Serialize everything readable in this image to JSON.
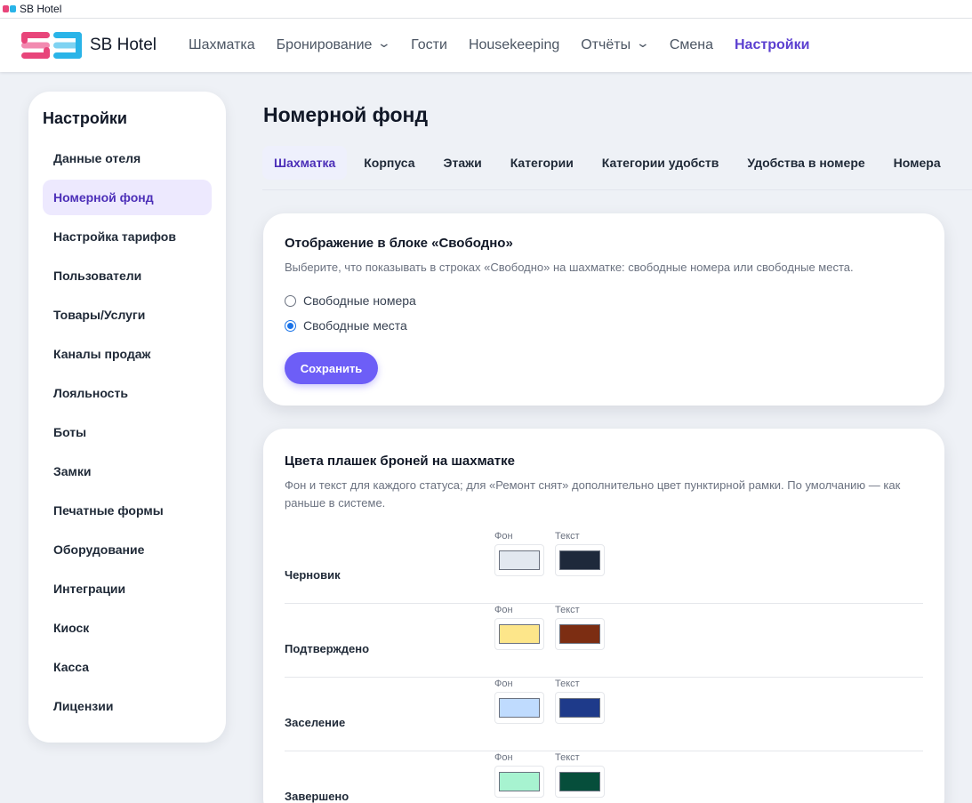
{
  "window": {
    "title": "SB Hotel"
  },
  "brand": {
    "name": "SB Hotel",
    "colors": {
      "pink": "#e8457a",
      "cyan": "#2ab4e8"
    }
  },
  "nav": {
    "items": [
      {
        "label": "Шахматка",
        "dropdown": false,
        "active": false
      },
      {
        "label": "Бронирование",
        "dropdown": true,
        "active": false
      },
      {
        "label": "Гости",
        "dropdown": false,
        "active": false
      },
      {
        "label": "Housekeeping",
        "dropdown": false,
        "active": false
      },
      {
        "label": "Отчёты",
        "dropdown": true,
        "active": false
      },
      {
        "label": "Смена",
        "dropdown": false,
        "active": false
      },
      {
        "label": "Настройки",
        "dropdown": false,
        "active": true
      }
    ]
  },
  "sidebar": {
    "title": "Настройки",
    "items": [
      {
        "label": "Данные отеля"
      },
      {
        "label": "Номерной фонд",
        "active": true
      },
      {
        "label": "Настройка тарифов"
      },
      {
        "label": "Пользователи"
      },
      {
        "label": "Товары/Услуги"
      },
      {
        "label": "Каналы продаж"
      },
      {
        "label": "Лояльность"
      },
      {
        "label": "Боты"
      },
      {
        "label": "Замки"
      },
      {
        "label": "Печатные формы"
      },
      {
        "label": "Оборудование"
      },
      {
        "label": "Интеграции"
      },
      {
        "label": "Киоск"
      },
      {
        "label": "Касса"
      },
      {
        "label": "Лицензии"
      }
    ]
  },
  "page": {
    "title": "Номерной фонд"
  },
  "tabs": [
    {
      "label": "Шахматка",
      "active": true
    },
    {
      "label": "Корпуса"
    },
    {
      "label": "Этажи"
    },
    {
      "label": "Категории"
    },
    {
      "label": "Категории удобств"
    },
    {
      "label": "Удобства в номере"
    },
    {
      "label": "Номера"
    }
  ],
  "free_display": {
    "title": "Отображение в блоке «Свободно»",
    "description": "Выберите, что показывать в строках «Свободно» на шахматке: свободные номера или свободные места.",
    "options": [
      {
        "label": "Свободные номера",
        "checked": false
      },
      {
        "label": "Свободные места",
        "checked": true
      }
    ],
    "save_label": "Сохранить"
  },
  "booking_colors": {
    "title": "Цвета плашек броней на шахматке",
    "description": "Фон и текст для каждого статуса; для «Ремонт снят» дополнительно цвет пунктирной рамки. По умолчанию — как раньше в системе.",
    "bg_caption": "Фон",
    "text_caption": "Текст",
    "rows": [
      {
        "status": "Черновик",
        "bg": "#e2e8f0",
        "text": "#1e293b"
      },
      {
        "status": "Подтверждено",
        "bg": "#fde68a",
        "text": "#7c2d12"
      },
      {
        "status": "Заселение",
        "bg": "#bfdbfe",
        "text": "#1e3a8a"
      },
      {
        "status": "Завершено",
        "bg": "#a7f3d0",
        "text": "#064e3b"
      }
    ]
  },
  "accent_color": "#6d5ef7"
}
